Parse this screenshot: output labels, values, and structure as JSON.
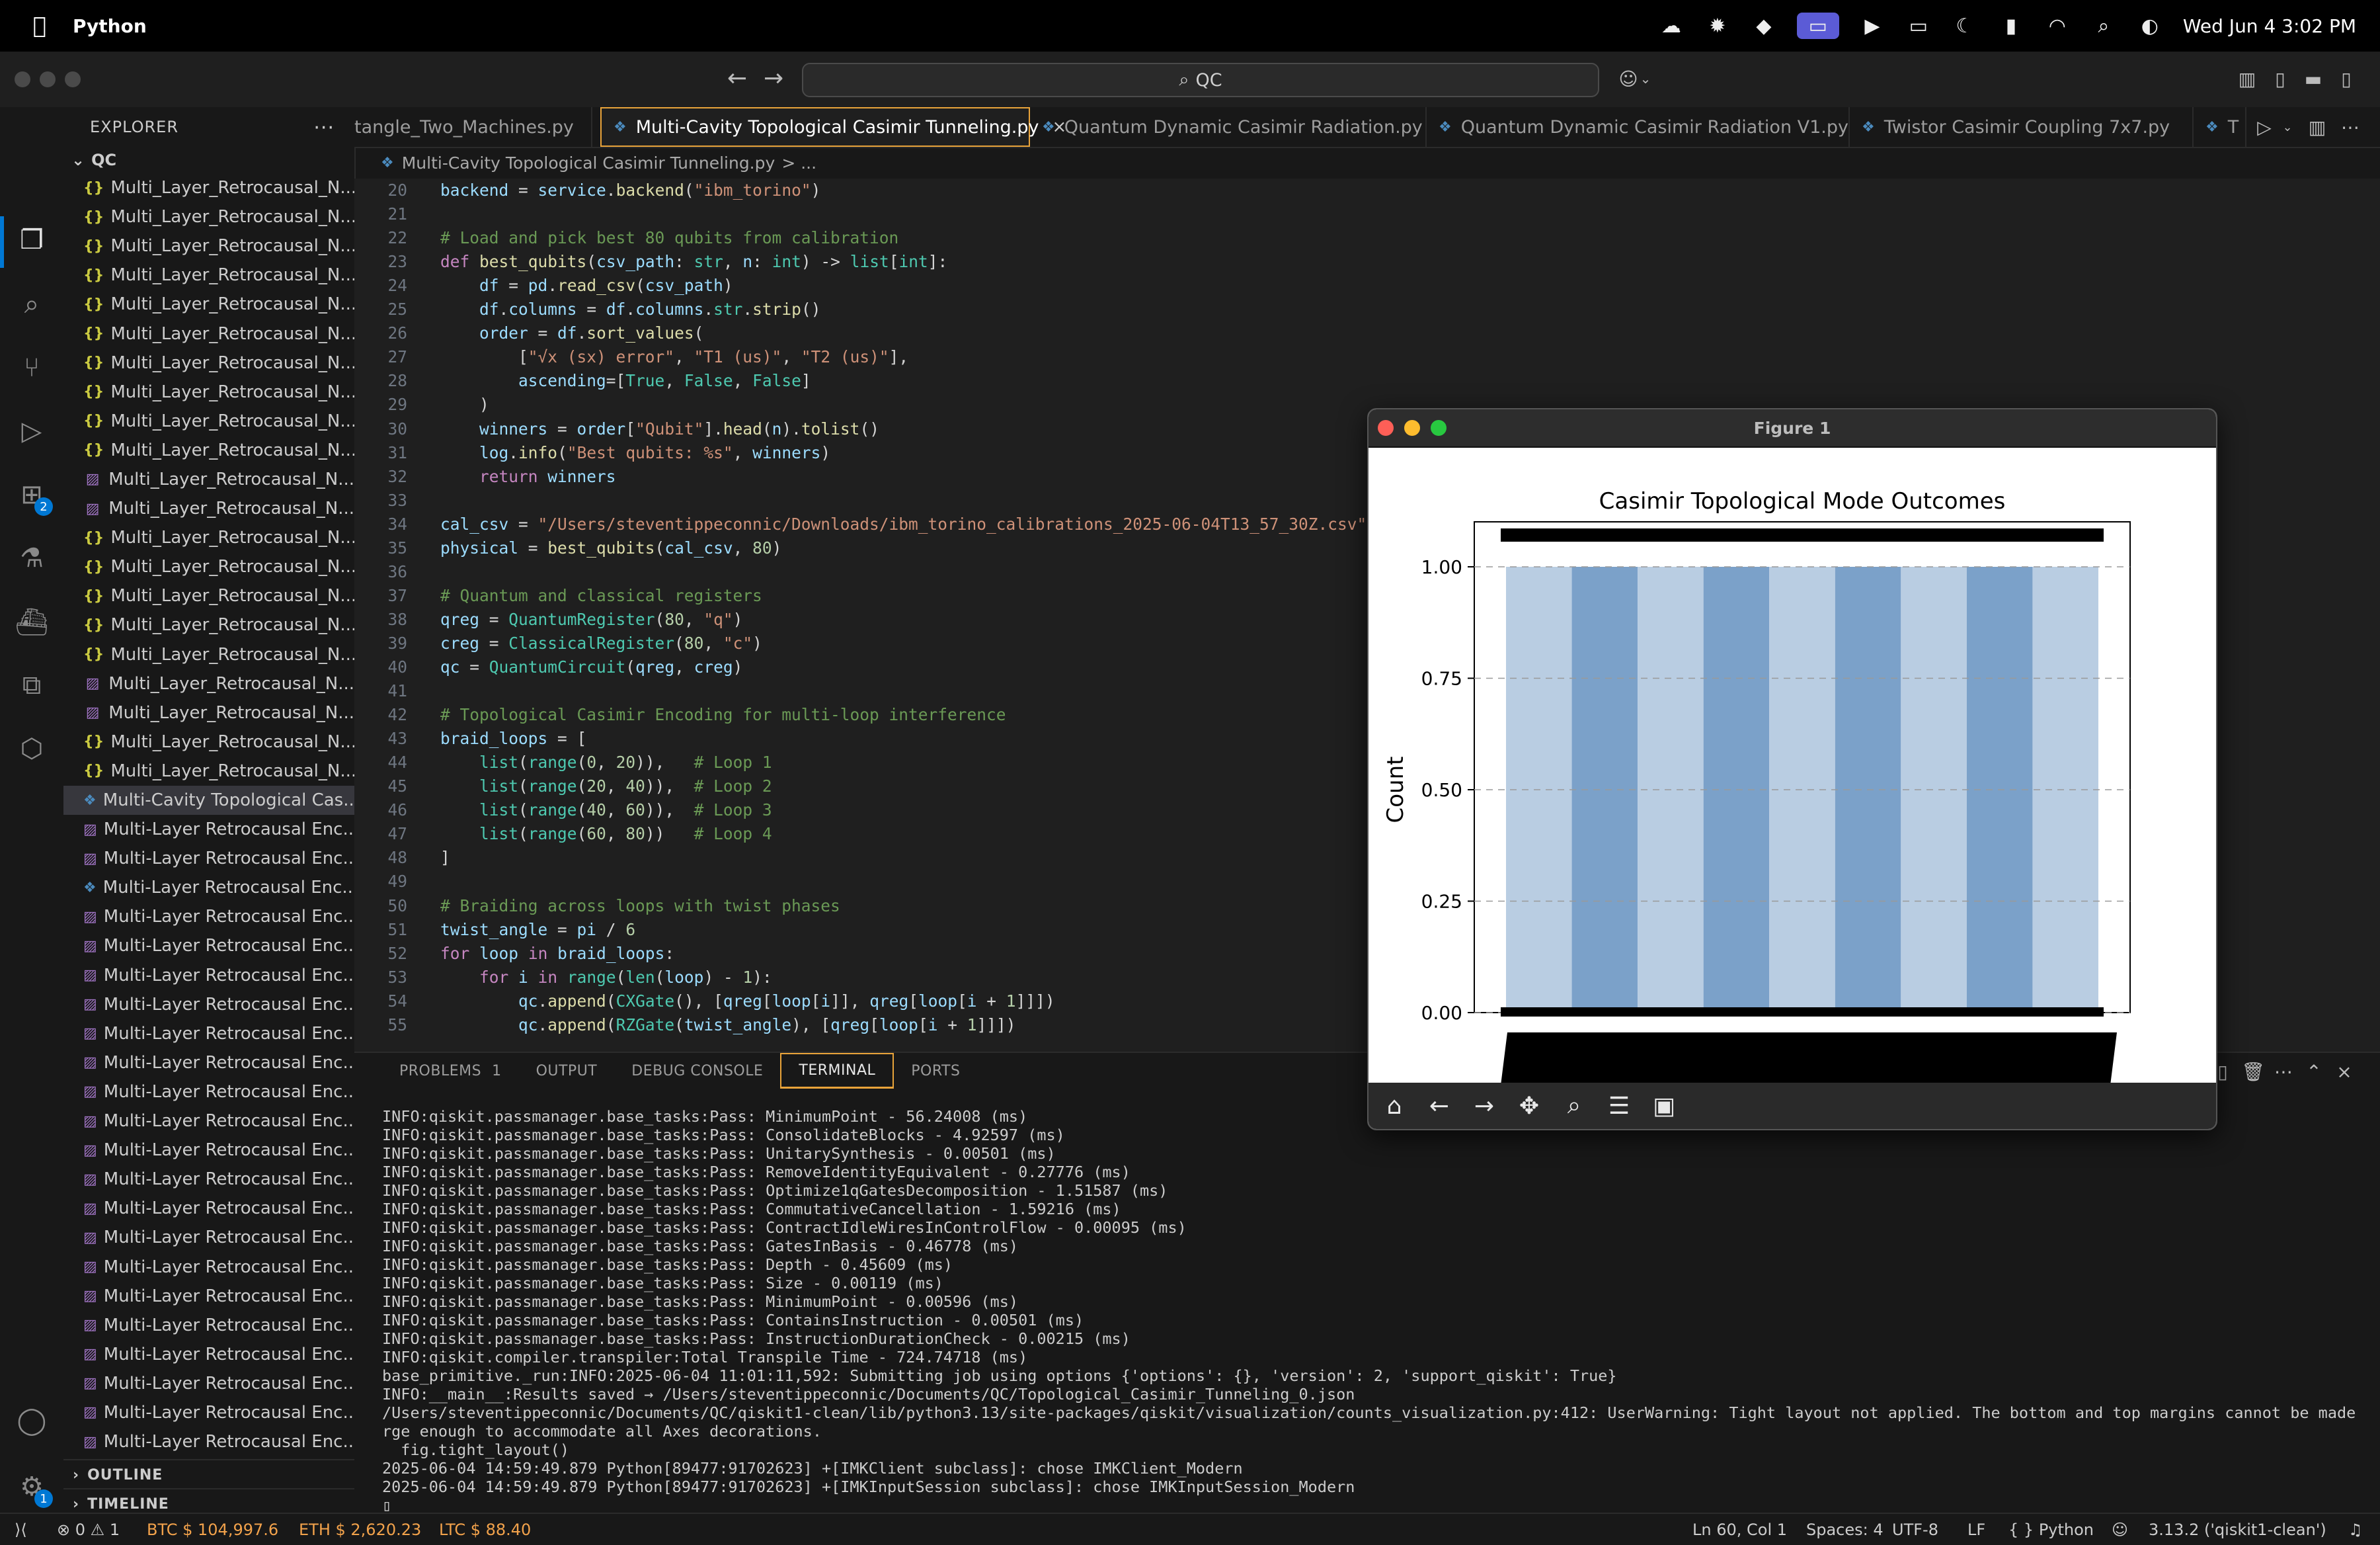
{
  "menubar": {
    "app_name": "Python",
    "clock": "Wed Jun 4  3:02 PM"
  },
  "titlebar": {
    "search_text": "QC",
    "copilot_label": "⌄"
  },
  "explorer": {
    "header": "EXPLORER",
    "more": "···",
    "root": "QC",
    "files": [
      {
        "name": "Multi_Layer_Retrocausal_N...",
        "type": "json"
      },
      {
        "name": "Multi_Layer_Retrocausal_N...",
        "type": "json"
      },
      {
        "name": "Multi_Layer_Retrocausal_N...",
        "type": "json"
      },
      {
        "name": "Multi_Layer_Retrocausal_N...",
        "type": "json"
      },
      {
        "name": "Multi_Layer_Retrocausal_N...",
        "type": "json"
      },
      {
        "name": "Multi_Layer_Retrocausal_N...",
        "type": "json"
      },
      {
        "name": "Multi_Layer_Retrocausal_N...",
        "type": "json"
      },
      {
        "name": "Multi_Layer_Retrocausal_N...",
        "type": "json"
      },
      {
        "name": "Multi_Layer_Retrocausal_N...",
        "type": "json"
      },
      {
        "name": "Multi_Layer_Retrocausal_N...",
        "type": "json"
      },
      {
        "name": "Multi_Layer_Retrocausal_N...",
        "type": "img"
      },
      {
        "name": "Multi_Layer_Retrocausal_N...",
        "type": "img"
      },
      {
        "name": "Multi_Layer_Retrocausal_N...",
        "type": "json"
      },
      {
        "name": "Multi_Layer_Retrocausal_N...",
        "type": "json"
      },
      {
        "name": "Multi_Layer_Retrocausal_N...",
        "type": "json"
      },
      {
        "name": "Multi_Layer_Retrocausal_N...",
        "type": "json"
      },
      {
        "name": "Multi_Layer_Retrocausal_N...",
        "type": "json"
      },
      {
        "name": "Multi_Layer_Retrocausal_N...",
        "type": "img"
      },
      {
        "name": "Multi_Layer_Retrocausal_N...",
        "type": "img"
      },
      {
        "name": "Multi_Layer_Retrocausal_N...",
        "type": "json"
      },
      {
        "name": "Multi_Layer_Retrocausal_N...",
        "type": "json"
      },
      {
        "name": "Multi-Cavity Topological Cas...",
        "type": "py",
        "active": true
      },
      {
        "name": "Multi-Layer Retrocausal Enc...",
        "type": "img"
      },
      {
        "name": "Multi-Layer Retrocausal Enc...",
        "type": "img"
      },
      {
        "name": "Multi-Layer Retrocausal Enc...",
        "type": "py"
      },
      {
        "name": "Multi-Layer Retrocausal Enc...",
        "type": "img"
      },
      {
        "name": "Multi-Layer Retrocausal Enc...",
        "type": "img"
      },
      {
        "name": "Multi-Layer Retrocausal Enc...",
        "type": "img"
      },
      {
        "name": "Multi-Layer Retrocausal Enc...",
        "type": "img"
      },
      {
        "name": "Multi-Layer Retrocausal Enc...",
        "type": "img"
      },
      {
        "name": "Multi-Layer Retrocausal Enc...",
        "type": "img"
      },
      {
        "name": "Multi-Layer Retrocausal Enc...",
        "type": "img"
      },
      {
        "name": "Multi-Layer Retrocausal Enc...",
        "type": "img"
      },
      {
        "name": "Multi-Layer Retrocausal Enc...",
        "type": "img"
      },
      {
        "name": "Multi-Layer Retrocausal Enc...",
        "type": "img"
      },
      {
        "name": "Multi-Layer Retrocausal Enc...",
        "type": "img"
      },
      {
        "name": "Multi-Layer Retrocausal Enc...",
        "type": "img"
      },
      {
        "name": "Multi-Layer Retrocausal Enc...",
        "type": "img"
      },
      {
        "name": "Multi-Layer Retrocausal Enc...",
        "type": "img"
      },
      {
        "name": "Multi-Layer Retrocausal Enc...",
        "type": "img"
      },
      {
        "name": "Multi-Layer Retrocausal Enc...",
        "type": "img"
      },
      {
        "name": "Multi-Layer Retrocausal Enc...",
        "type": "img"
      },
      {
        "name": "Multi-Layer Retrocausal Enc...",
        "type": "img"
      },
      {
        "name": "Multi-Layer Retrocausal Enc...",
        "type": "img"
      }
    ],
    "outline": "OUTLINE",
    "timeline": "TIMELINE"
  },
  "tabs": [
    {
      "label": "tangle_Two_Machines.py",
      "icon": false
    },
    {
      "label": "Multi-Cavity Topological Casimir Tunneling.py",
      "icon": true,
      "active": true
    },
    {
      "label": "Quantum Dynamic Casimir Radiation.py",
      "icon": true
    },
    {
      "label": "Quantum Dynamic Casimir Radiation V1.py",
      "icon": true
    },
    {
      "label": "Twistor Casimir Coupling 7x7.py",
      "icon": true
    },
    {
      "label": "T",
      "icon": true
    }
  ],
  "breadcrumb": {
    "file": "Multi-Cavity Topological Casimir Tunneling.py",
    "rest": "> ..."
  },
  "editor": {
    "lines": [
      {
        "n": "20",
        "text": "backend = service.backend(\"ibm_torino\")"
      },
      {
        "n": "21",
        "text": ""
      },
      {
        "n": "22",
        "text": "# Load and pick best 80 qubits from calibration"
      },
      {
        "n": "23",
        "text": "def best_qubits(csv_path: str, n: int) -> list[int]:"
      },
      {
        "n": "24",
        "text": "    df = pd.read_csv(csv_path)"
      },
      {
        "n": "25",
        "text": "    df.columns = df.columns.str.strip()"
      },
      {
        "n": "26",
        "text": "    order = df.sort_values("
      },
      {
        "n": "27",
        "text": "        [\"√x (sx) error\", \"T1 (us)\", \"T2 (us)\"],"
      },
      {
        "n": "28",
        "text": "        ascending=[True, False, False]"
      },
      {
        "n": "29",
        "text": "    )"
      },
      {
        "n": "30",
        "text": "    winners = order[\"Qubit\"].head(n).tolist()"
      },
      {
        "n": "31",
        "text": "    log.info(\"Best qubits: %s\", winners)"
      },
      {
        "n": "32",
        "text": "    return winners"
      },
      {
        "n": "33",
        "text": ""
      },
      {
        "n": "34",
        "text": "cal_csv = \"/Users/steventippeconnic/Downloads/ibm_torino_calibrations_2025-06-04T13_57_30Z.csv\""
      },
      {
        "n": "35",
        "text": "physical = best_qubits(cal_csv, 80)"
      },
      {
        "n": "36",
        "text": ""
      },
      {
        "n": "37",
        "text": "# Quantum and classical registers"
      },
      {
        "n": "38",
        "text": "qreg = QuantumRegister(80, \"q\")"
      },
      {
        "n": "39",
        "text": "creg = ClassicalRegister(80, \"c\")"
      },
      {
        "n": "40",
        "text": "qc = QuantumCircuit(qreg, creg)"
      },
      {
        "n": "41",
        "text": ""
      },
      {
        "n": "42",
        "text": "# Topological Casimir Encoding for multi-loop interference"
      },
      {
        "n": "43",
        "text": "braid_loops = ["
      },
      {
        "n": "44",
        "text": "    list(range(0, 20)),   # Loop 1"
      },
      {
        "n": "45",
        "text": "    list(range(20, 40)),  # Loop 2"
      },
      {
        "n": "46",
        "text": "    list(range(40, 60)),  # Loop 3"
      },
      {
        "n": "47",
        "text": "    list(range(60, 80))   # Loop 4"
      },
      {
        "n": "48",
        "text": "]"
      },
      {
        "n": "49",
        "text": ""
      },
      {
        "n": "50",
        "text": "# Braiding across loops with twist phases"
      },
      {
        "n": "51",
        "text": "twist_angle = pi / 6"
      },
      {
        "n": "52",
        "text": "for loop in braid_loops:"
      },
      {
        "n": "53",
        "text": "    for i in range(len(loop) - 1):"
      },
      {
        "n": "54",
        "text": "        qc.append(CXGate(), [qreg[loop[i]], qreg[loop[i + 1]]])"
      },
      {
        "n": "55",
        "text": "        qc.append(RZGate(twist_angle), [qreg[loop[i + 1]]])"
      }
    ]
  },
  "figure": {
    "window_title": "Figure 1"
  },
  "chart_data": {
    "type": "bar",
    "title": "Casimir Topological Mode Outcomes",
    "xlabel": "",
    "ylabel": "Count",
    "ylim": [
      0,
      1.0
    ],
    "yticks": [
      "0.00",
      "0.25",
      "0.50",
      "0.75",
      "1.00"
    ],
    "values": [
      1,
      1,
      1,
      1,
      1,
      1,
      1,
      1,
      1
    ],
    "bar_colors": [
      "#b9cde2",
      "#7ba1c9",
      "#b9cde2",
      "#7ba1c9",
      "#b9cde2",
      "#7ba1c9",
      "#b9cde2",
      "#7ba1c9",
      "#b9cde2"
    ],
    "grid": "y-dashed"
  },
  "panel": {
    "tabs": [
      {
        "label": "PROBLEMS",
        "count": "1"
      },
      {
        "label": "OUTPUT"
      },
      {
        "label": "DEBUG CONSOLE"
      },
      {
        "label": "TERMINAL",
        "active": true
      },
      {
        "label": "PORTS"
      }
    ],
    "terminal_lines": [
      "INFO:qiskit.passmanager.base_tasks:Pass: MinimumPoint - 56.24008 (ms)",
      "INFO:qiskit.passmanager.base_tasks:Pass: ConsolidateBlocks - 4.92597 (ms)",
      "INFO:qiskit.passmanager.base_tasks:Pass: UnitarySynthesis - 0.00501 (ms)",
      "INFO:qiskit.passmanager.base_tasks:Pass: RemoveIdentityEquivalent - 0.27776 (ms)",
      "INFO:qiskit.passmanager.base_tasks:Pass: Optimize1qGatesDecomposition - 1.51587 (ms)",
      "INFO:qiskit.passmanager.base_tasks:Pass: CommutativeCancellation - 1.59216 (ms)",
      "INFO:qiskit.passmanager.base_tasks:Pass: ContractIdleWiresInControlFlow - 0.00095 (ms)",
      "INFO:qiskit.passmanager.base_tasks:Pass: GatesInBasis - 0.46778 (ms)",
      "INFO:qiskit.passmanager.base_tasks:Pass: Depth - 0.45609 (ms)",
      "INFO:qiskit.passmanager.base_tasks:Pass: Size - 0.00119 (ms)",
      "INFO:qiskit.passmanager.base_tasks:Pass: MinimumPoint - 0.00596 (ms)",
      "INFO:qiskit.passmanager.base_tasks:Pass: ContainsInstruction - 0.00501 (ms)",
      "INFO:qiskit.passmanager.base_tasks:Pass: InstructionDurationCheck - 0.00215 (ms)",
      "INFO:qiskit.compiler.transpiler:Total Transpile Time - 724.74718 (ms)",
      "base_primitive._run:INFO:2025-06-04 11:01:11,592: Submitting job using options {'options': {}, 'version': 2, 'support_qiskit': True}",
      "INFO:__main__:Results saved → /Users/steventippeconnic/Documents/QC/Topological_Casimir_Tunneling_0.json",
      "/Users/steventippeconnic/Documents/QC/qiskit1-clean/lib/python3.13/site-packages/qiskit/visualization/counts_visualization.py:412: UserWarning: Tight layout not applied. The bottom and top margins cannot be made la",
      "rge enough to accommodate all Axes decorations.",
      "  fig.tight_layout()",
      "2025-06-04 14:59:49.879 Python[89477:91702623] +[IMKClient subclass]: chose IMKClient_Modern",
      "2025-06-04 14:59:49.879 Python[89477:91702623] +[IMKInputSession subclass]: chose IMKInputSession_Modern",
      "▯"
    ]
  },
  "statusbar": {
    "errors": "0",
    "warnings": "1",
    "btc": "BTC $ 104,997.6",
    "eth": "ETH $ 2,620.23",
    "ltc": "LTC $ 88.40",
    "position": "Ln 60, Col 1",
    "spaces": "Spaces: 4",
    "encoding": "UTF-8",
    "eol": "LF",
    "language": "Python",
    "interpreter": "3.13.2 ('qiskit1-clean')"
  }
}
